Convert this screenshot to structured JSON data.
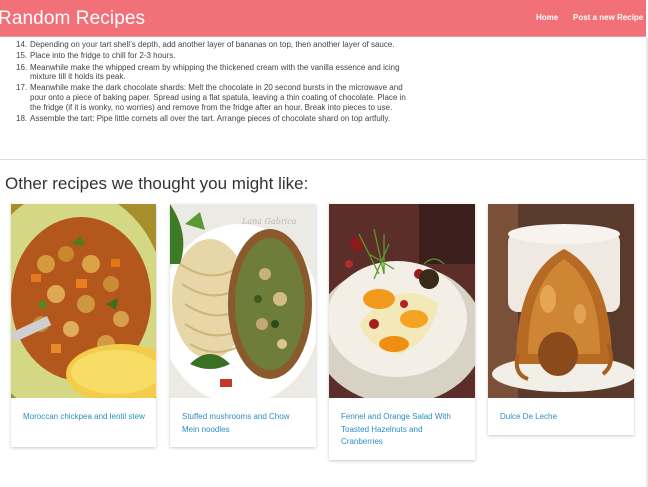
{
  "navbar": {
    "brand": "Random Recipes",
    "links": [
      "Home",
      "Post a new Recipe"
    ]
  },
  "steps": [
    {
      "num": "14.",
      "text": "Depending on your tart shell’s depth, add another layer of bananas on top, then another layer of sauce."
    },
    {
      "num": "15.",
      "text": "Place into the fridge to chill for 2-3 hours."
    },
    {
      "num": "16.",
      "text": "Meanwhile make the whipped cream by whipping the thickened cream with the vanilla essence and icing mixture till it holds its peak."
    },
    {
      "num": "17.",
      "text": "Meanwhile make the dark chocolate shards: Melt the chocolate in 20 second bursts in the microwave and pour onto a piece of baking paper. Spread using a flat spatula, leaving a thin coating of chocolate. Place in the fridge (if it is wonky, no worries) and remove from the fridge after an hour. Break into pieces to use."
    },
    {
      "num": "18.",
      "text": "Assemble the tart: Pipe little cornets all over the tart. Arrange pieces of chocolate shard on top artfully."
    }
  ],
  "related": {
    "title": "Other recipes we thought you might like:",
    "recipes": [
      {
        "title": "Moroccan chickpea and lentil stew"
      },
      {
        "title": "Stuffed mushrooms and Chow Mein noodles",
        "watermark": "Lana Gabrica"
      },
      {
        "title": "Fennel and Orange Salad With Toasted Hazelnuts and Cranberries"
      },
      {
        "title": "Dulce De Leche"
      }
    ]
  }
}
